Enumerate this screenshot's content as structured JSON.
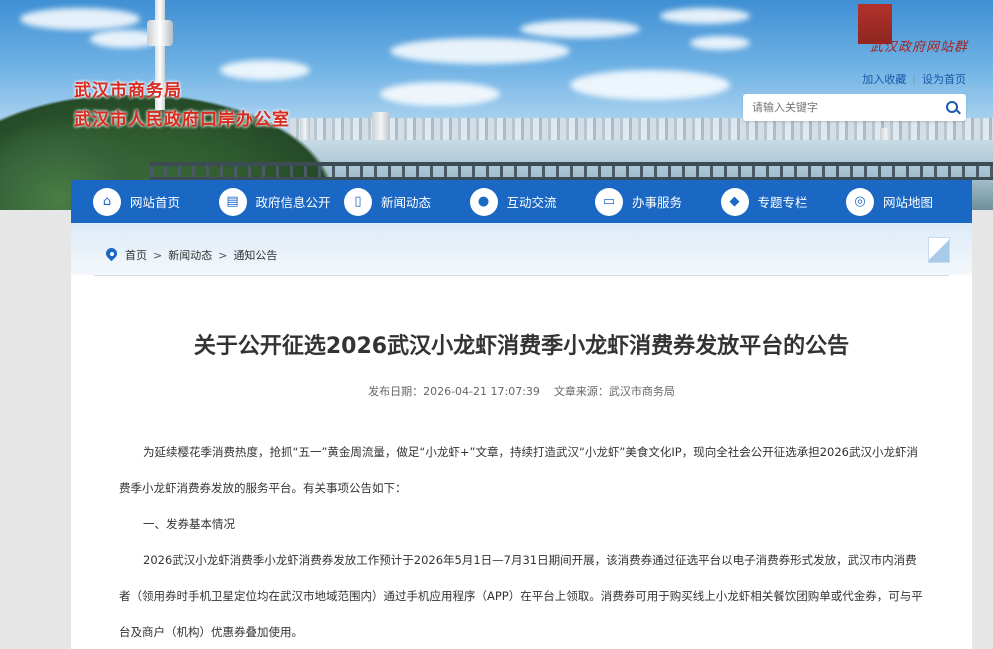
{
  "header": {
    "org_line1": "武汉市商务局",
    "org_line2": "武汉市人民政府口岸办公室",
    "calligraphy": "武汉政府网站群",
    "links": [
      "加入收藏",
      "设为首页"
    ],
    "search_placeholder": "请输入关键字"
  },
  "nav": {
    "items": [
      {
        "label": "网站首页",
        "icon": "home-icon"
      },
      {
        "label": "政府信息公开",
        "icon": "document-icon"
      },
      {
        "label": "新闻动态",
        "icon": "book-icon"
      },
      {
        "label": "互动交流",
        "icon": "chat-icon"
      },
      {
        "label": "办事服务",
        "icon": "monitor-icon"
      },
      {
        "label": "专题专栏",
        "icon": "cube-icon"
      },
      {
        "label": "网站地图",
        "icon": "globe-icon"
      }
    ]
  },
  "breadcrumb": {
    "items": [
      "首页",
      "新闻动态",
      "通知公告"
    ],
    "separator": ">"
  },
  "article": {
    "title": "关于公开征选2026武汉小龙虾消费季小龙虾消费券发放平台的公告",
    "publish_label": "发布日期：",
    "publish_date": "2026-04-21 17:07:39",
    "source_label": "文章来源：",
    "source": "武汉市商务局",
    "paragraphs": [
      "为延续樱花季消费热度，抢抓“五一”黄金周流量，做足“小龙虾+”文章，持续打造武汉“小龙虾”美食文化IP，现向全社会公开征选承担2026武汉小龙虾消费季小龙虾消费券发放的服务平台。有关事项公告如下：",
      "一、发券基本情况",
      "2026武汉小龙虾消费季小龙虾消费券发放工作预计于2026年5月1日—7月31日期间开展，该消费券通过征选平台以电子消费券形式发放，武汉市内消费者（领用券时手机卫星定位均在武汉市地域范围内）通过手机应用程序（APP）在平台上领取。消费券可用于购买线上小龙虾相关餐饮团购单或代金券，可与平台及商户（机构）优惠券叠加使用。"
    ]
  },
  "colors": {
    "nav_bg": "#1a67c4",
    "org_title": "#d92b1f",
    "link": "#1b56a6"
  }
}
